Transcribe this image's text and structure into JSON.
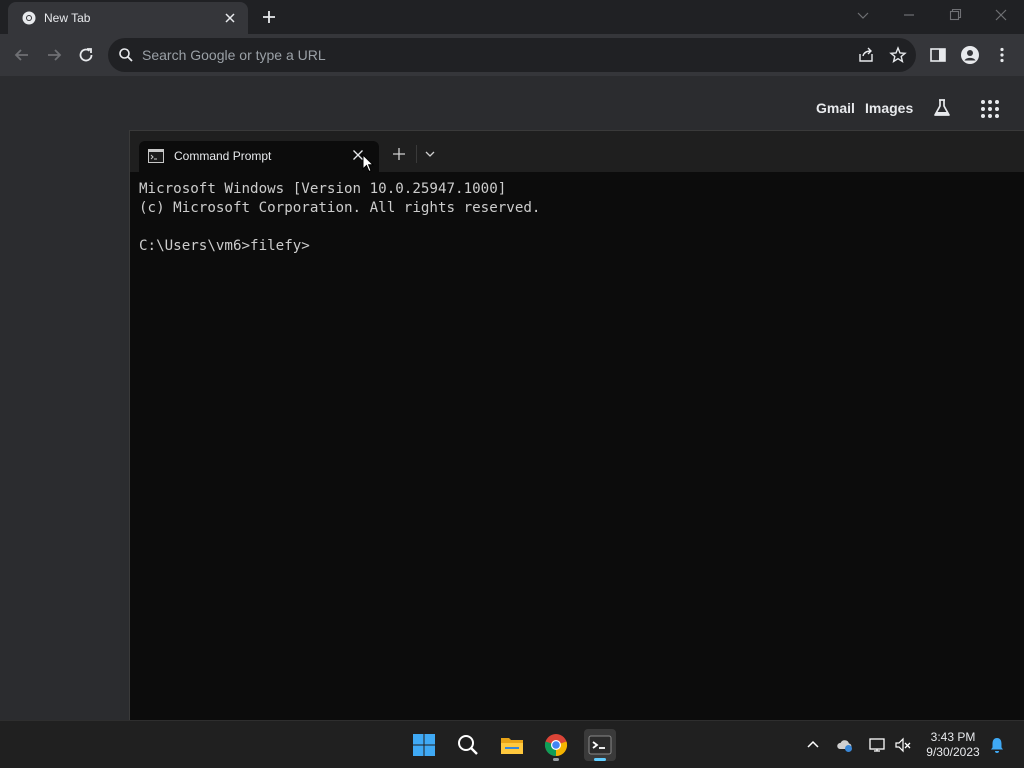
{
  "browser": {
    "tab_title": "New Tab",
    "omnibox_placeholder": "Search Google or type a URL"
  },
  "ntp": {
    "gmail": "Gmail",
    "images": "Images"
  },
  "terminal": {
    "tab_title": "Command Prompt",
    "lines": [
      "Microsoft Windows [Version 10.0.25947.1000]",
      "(c) Microsoft Corporation. All rights reserved.",
      "",
      "C:\\Users\\vm6>filefy>"
    ]
  },
  "taskbar": {
    "time": "3:43 PM",
    "date": "9/30/2023"
  },
  "colors": {
    "accent": "#60cdff",
    "terminal_bg": "#0c0c0c",
    "browser_bg": "#2b2c2f"
  }
}
